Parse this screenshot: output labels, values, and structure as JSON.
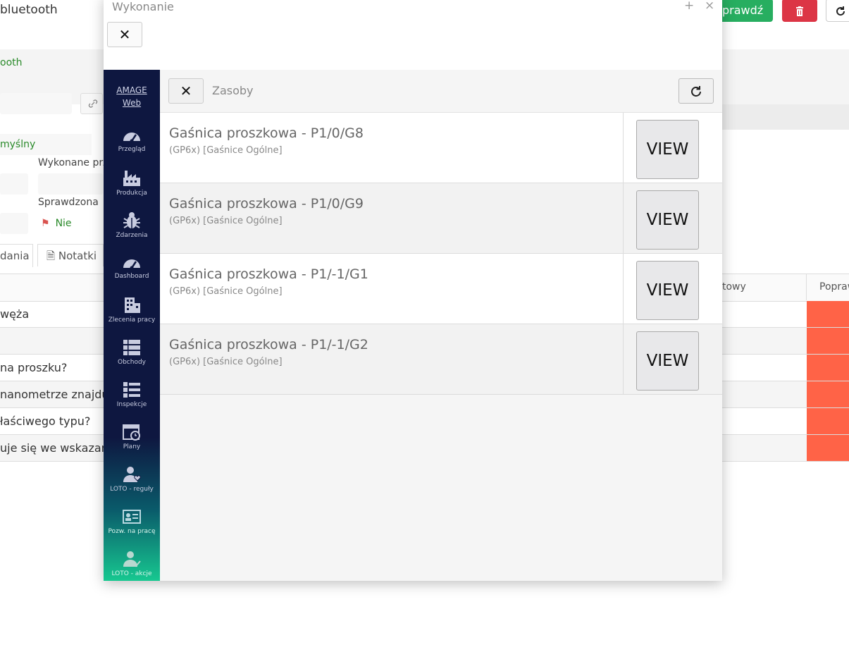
{
  "background": {
    "title": "bluetooth",
    "link": "ooth",
    "field_value": "myślny",
    "label_wykonane": "Wykonane prz",
    "label_sprawdzona": "Sprawdzona",
    "sprawdzona_value": "Nie",
    "tab_zadania": "dania",
    "tab_notatki": "Notatki",
    "col_tow": "towy",
    "col_popraw": "Popraw",
    "rows": [
      "węża",
      "",
      "na proszku?",
      "nanometrze znajduj",
      "łaściwego typu?",
      "uje się we wskazany"
    ],
    "btn_sprawdz": "prawdź",
    "colors": {
      "green": "#27ae60",
      "red": "#dc3545",
      "row_red": "#ff6347"
    }
  },
  "modal": {
    "title": "Wykonanie",
    "maximize": "+",
    "close": "×",
    "close_button": "✕"
  },
  "sidebar": {
    "brand_line1": "AMAGE",
    "brand_line2": "Web",
    "items": [
      {
        "label": "Przegląd",
        "icon": "gauge-icon"
      },
      {
        "label": "Produkcja",
        "icon": "factory-icon"
      },
      {
        "label": "Zdarzenia",
        "icon": "bug-icon"
      },
      {
        "label": "Dashboard",
        "icon": "gauge-icon"
      },
      {
        "label": "Zlecenia pracy",
        "icon": "building-icon"
      },
      {
        "label": "Obchody",
        "icon": "list-icon"
      },
      {
        "label": "Inspekcje",
        "icon": "checklist-icon"
      },
      {
        "label": "Plany",
        "icon": "calendar-clock-icon"
      },
      {
        "label": "LOTO - reguły",
        "icon": "user-heart-icon"
      },
      {
        "label": "Pozw. na pracę",
        "icon": "id-card-icon"
      },
      {
        "label": "LOTO - akcje",
        "icon": "user-check-icon"
      }
    ]
  },
  "toolbar": {
    "close": "✕",
    "title": "Zasoby",
    "refresh_icon": "refresh-icon"
  },
  "items": [
    {
      "name": "Gaśnica proszkowa - P1/0/G8",
      "sub": "(GP6x) [Gaśnice Ogólne]",
      "button": "VIEW"
    },
    {
      "name": "Gaśnica proszkowa - P1/0/G9",
      "sub": "(GP6x) [Gaśnice Ogólne]",
      "button": "VIEW"
    },
    {
      "name": "Gaśnica proszkowa - P1/-1/G1",
      "sub": "(GP6x) [Gaśnice Ogólne]",
      "button": "VIEW"
    },
    {
      "name": "Gaśnica proszkowa - P1/-1/G2",
      "sub": "(GP6x) [Gaśnice Ogólne]",
      "button": "VIEW"
    }
  ]
}
